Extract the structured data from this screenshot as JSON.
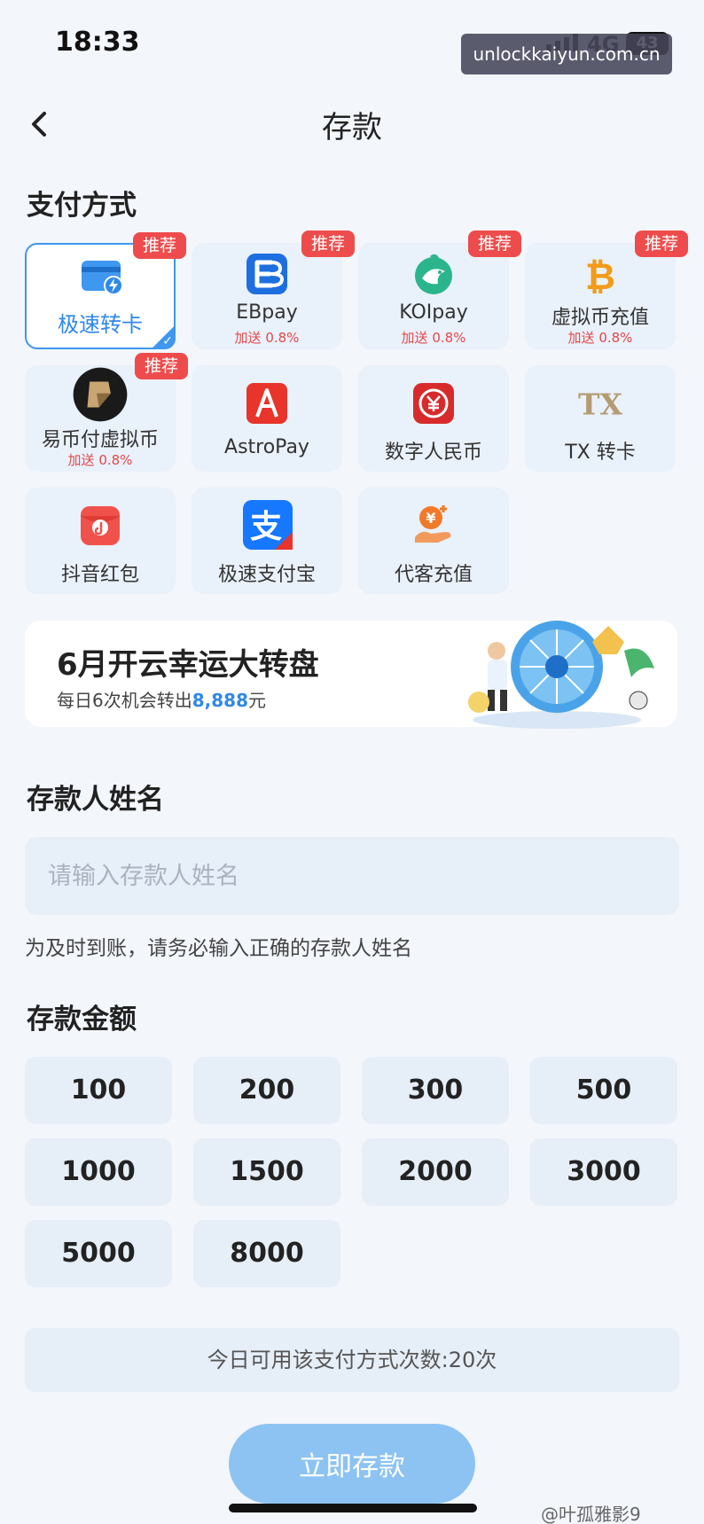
{
  "status": {
    "time": "18:33",
    "network": "4G",
    "battery": "43"
  },
  "watermark_top": "unlockkaiyun.com.cn",
  "nav": {
    "title": "存款"
  },
  "payment": {
    "section_title": "支付方式",
    "methods": [
      {
        "name": "极速转卡",
        "bonus": "",
        "badge": "推荐",
        "selected": true,
        "icon": "card-bolt-icon"
      },
      {
        "name": "EBpay",
        "bonus": "加送 0.8%",
        "badge": "推荐",
        "icon": "ebpay-icon"
      },
      {
        "name": "KOIpay",
        "bonus": "加送 0.8%",
        "badge": "推荐",
        "icon": "koi-fish-icon"
      },
      {
        "name": "虚拟币充值",
        "bonus": "加送 0.8%",
        "badge": "推荐",
        "icon": "bitcoin-icon"
      },
      {
        "name": "易币付虚拟币",
        "bonus": "加送 0.8%",
        "badge": "推荐",
        "icon": "yibifu-icon"
      },
      {
        "name": "AstroPay",
        "bonus": "",
        "badge": "",
        "icon": "astropay-icon"
      },
      {
        "name": "数字人民币",
        "bonus": "",
        "badge": "",
        "icon": "digital-rmb-icon"
      },
      {
        "name": "TX 转卡",
        "bonus": "",
        "badge": "",
        "icon": "tx-icon"
      },
      {
        "name": "抖音红包",
        "bonus": "",
        "badge": "",
        "icon": "douyin-redpacket-icon"
      },
      {
        "name": "极速支付宝",
        "bonus": "",
        "badge": "",
        "icon": "alipay-icon"
      },
      {
        "name": "代客充值",
        "bonus": "",
        "badge": "",
        "icon": "agent-topup-icon"
      }
    ]
  },
  "banner": {
    "title": "6月开云幸运大转盘",
    "sub_prefix": "每日6次机会转出",
    "sub_amount": "8,888",
    "sub_suffix": "元"
  },
  "depositor": {
    "section_title": "存款人姓名",
    "placeholder": "请输入存款人姓名",
    "hint": "为及时到账，请务必输入正确的存款人姓名"
  },
  "amount": {
    "section_title": "存款金额",
    "options": [
      "100",
      "200",
      "300",
      "500",
      "1000",
      "1500",
      "2000",
      "3000",
      "5000",
      "8000"
    ]
  },
  "usage_text": "今日可用该支付方式次数:20次",
  "submit_label": "立即存款",
  "watermark_bottom": "@叶孤雅影9",
  "colors": {
    "accent": "#3f97f0",
    "badge": "#ee4c4c",
    "submit": "#8cc3f2"
  }
}
